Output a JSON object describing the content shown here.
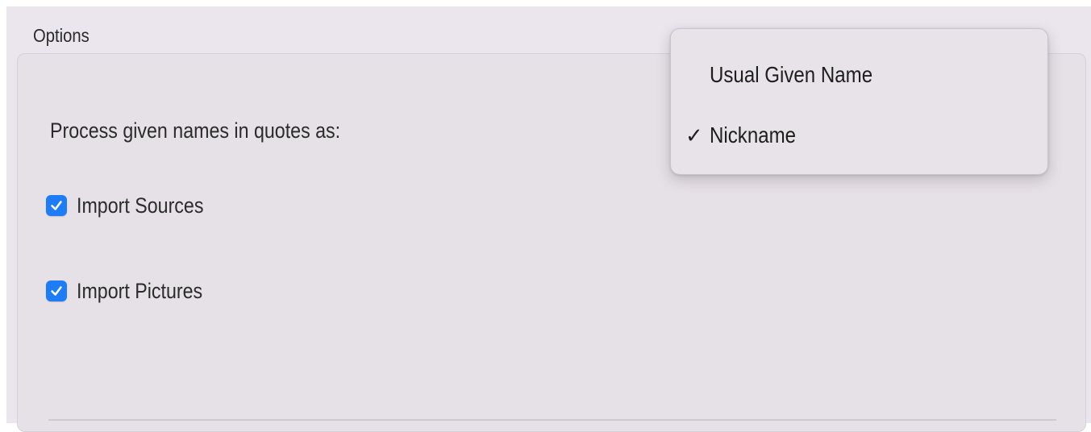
{
  "section": {
    "title": "Options"
  },
  "form": {
    "process_label": "Process given names in quotes as:",
    "checkboxes": [
      {
        "label": "Import Sources",
        "checked": true
      },
      {
        "label": "Import Pictures",
        "checked": true
      }
    ]
  },
  "dropdown_menu": {
    "items": [
      {
        "label": "Usual Given Name",
        "selected": false
      },
      {
        "label": "Nickname",
        "selected": true,
        "check": "✓"
      }
    ]
  },
  "colors": {
    "accent": "#1f7cf7",
    "background": "#e6e1e7",
    "menu_background": "#e8e3e9"
  }
}
